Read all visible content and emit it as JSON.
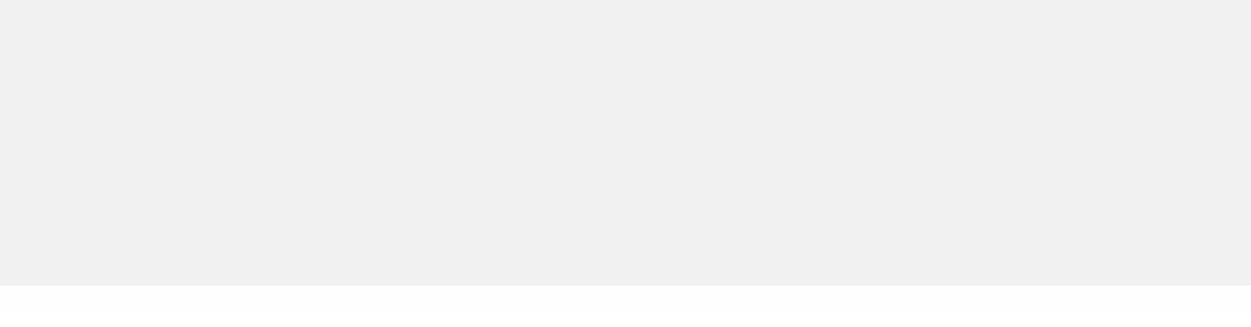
{
  "colors": {
    "panel_background": "#f1f1f1",
    "page_background": "#ffffff"
  }
}
